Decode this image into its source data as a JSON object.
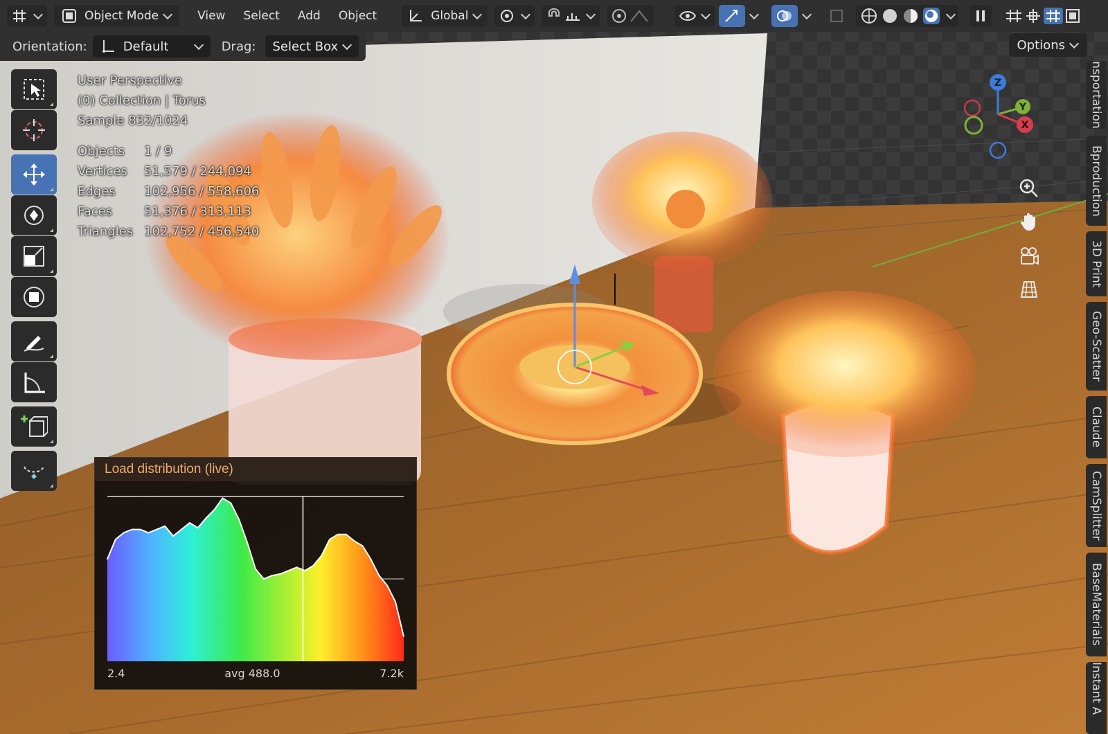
{
  "header": {
    "mode_label": "Object Mode",
    "menus": [
      "View",
      "Select",
      "Add",
      "Object"
    ],
    "transform_label": "Global"
  },
  "subheader": {
    "orientation_label": "Orientation:",
    "orientation_value": "Default",
    "drag_label": "Drag:",
    "drag_value": "Select Box",
    "options_label": "Options"
  },
  "overlay": {
    "perspective": "User Perspective",
    "collection": "(0) Collection | Torus",
    "sample": "Sample 832/1024",
    "stats": [
      {
        "label": "Objects",
        "value": "1 / 9"
      },
      {
        "label": "Vertices",
        "value": "51,579 / 244,094"
      },
      {
        "label": "Edges",
        "value": "102,956 / 558,606"
      },
      {
        "label": "Faces",
        "value": "51,376 / 313,113"
      },
      {
        "label": "Triangles",
        "value": "102,752 / 456,540"
      }
    ]
  },
  "gizmo": {
    "axes": [
      "Z",
      "Y",
      "X"
    ]
  },
  "side_tabs": [
    "Transportation",
    "Bproduction",
    "3D Print",
    "Geo-Scatter",
    "Claude",
    "CamSplitter",
    "BaseMaterials",
    "Instant A"
  ],
  "tools": [
    "select-box-icon",
    "cursor-icon",
    "move-icon",
    "rotate-icon",
    "scale-icon",
    "transform-icon",
    "annotate-icon",
    "measure-icon",
    "add-cube-icon",
    "shear-icon"
  ],
  "panel": {
    "title": "Load distribution (live)",
    "foot_min": "2.4",
    "foot_avg": "avg 488.0",
    "foot_max": "7.2k"
  },
  "chart_data": {
    "type": "area",
    "title": "Load distribution (live)",
    "x_min_label": "2.4",
    "x_max_label": "7.2k",
    "avg_label": "avg 488.0",
    "marker_position_fraction": 0.66,
    "color_scale": "spectral (blue → cyan → green → yellow → red)",
    "values": [
      0.62,
      0.74,
      0.78,
      0.8,
      0.8,
      0.78,
      0.8,
      0.82,
      0.76,
      0.8,
      0.84,
      0.81,
      0.87,
      0.92,
      0.99,
      0.96,
      0.86,
      0.72,
      0.56,
      0.5,
      0.52,
      0.53,
      0.55,
      0.57,
      0.55,
      0.58,
      0.64,
      0.74,
      0.77,
      0.77,
      0.73,
      0.7,
      0.62,
      0.52,
      0.46,
      0.36,
      0.15
    ]
  }
}
